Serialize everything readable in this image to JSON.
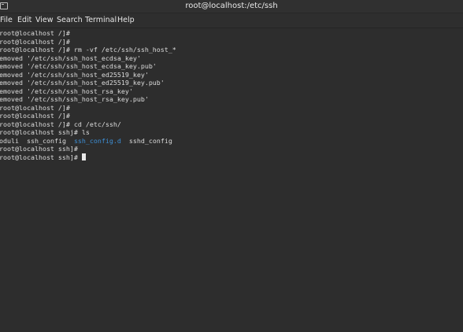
{
  "window": {
    "title": "root@localhost:/etc/ssh"
  },
  "menu": {
    "items": [
      "File",
      "Edit",
      "View",
      "Search",
      "Terminal",
      "Help"
    ]
  },
  "terminal": {
    "lines": [
      "root@localhost /]#",
      "root@localhost /]#",
      "root@localhost /]# rm -vf /etc/ssh/ssh_host_*",
      "emoved '/etc/ssh/ssh_host_ecdsa_key'",
      "emoved '/etc/ssh/ssh_host_ecdsa_key.pub'",
      "emoved '/etc/ssh/ssh_host_ed25519_key'",
      "emoved '/etc/ssh/ssh_host_ed25519_key.pub'",
      "emoved '/etc/ssh/ssh_host_rsa_key'",
      "emoved '/etc/ssh/ssh_host_rsa_key.pub'",
      "root@localhost /]#",
      "root@localhost /]#",
      "root@localhost /]# cd /etc/ssh/",
      "root@localhost sshj# ls"
    ],
    "ls_output": {
      "item1": "oduli",
      "item2": "ssh_config",
      "item3": "ssh_config.d",
      "item4": "sshd_config"
    },
    "after_lines": [
      "root@localhost ssh]#",
      "root@localhost ssh]#"
    ],
    "colors": {
      "background": "#2d2d2d",
      "text": "#dcdcdc",
      "directory": "#3d8fd6"
    }
  }
}
